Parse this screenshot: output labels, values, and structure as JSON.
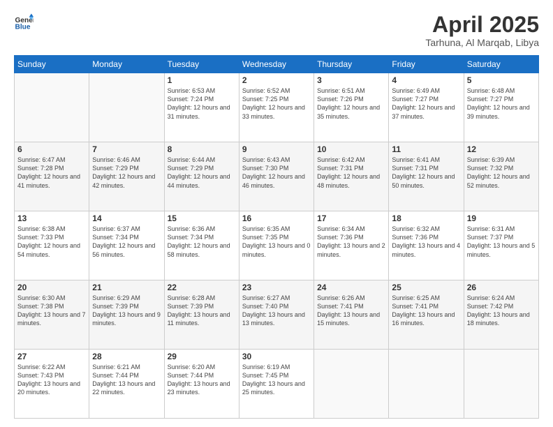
{
  "header": {
    "logo": {
      "line1": "General",
      "line2": "Blue"
    },
    "title": "April 2025",
    "subtitle": "Tarhuna, Al Marqab, Libya"
  },
  "weekdays": [
    "Sunday",
    "Monday",
    "Tuesday",
    "Wednesday",
    "Thursday",
    "Friday",
    "Saturday"
  ],
  "weeks": [
    [
      {
        "day": "",
        "sunrise": "",
        "sunset": "",
        "daylight": ""
      },
      {
        "day": "",
        "sunrise": "",
        "sunset": "",
        "daylight": ""
      },
      {
        "day": "1",
        "sunrise": "Sunrise: 6:53 AM",
        "sunset": "Sunset: 7:24 PM",
        "daylight": "Daylight: 12 hours and 31 minutes."
      },
      {
        "day": "2",
        "sunrise": "Sunrise: 6:52 AM",
        "sunset": "Sunset: 7:25 PM",
        "daylight": "Daylight: 12 hours and 33 minutes."
      },
      {
        "day": "3",
        "sunrise": "Sunrise: 6:51 AM",
        "sunset": "Sunset: 7:26 PM",
        "daylight": "Daylight: 12 hours and 35 minutes."
      },
      {
        "day": "4",
        "sunrise": "Sunrise: 6:49 AM",
        "sunset": "Sunset: 7:27 PM",
        "daylight": "Daylight: 12 hours and 37 minutes."
      },
      {
        "day": "5",
        "sunrise": "Sunrise: 6:48 AM",
        "sunset": "Sunset: 7:27 PM",
        "daylight": "Daylight: 12 hours and 39 minutes."
      }
    ],
    [
      {
        "day": "6",
        "sunrise": "Sunrise: 6:47 AM",
        "sunset": "Sunset: 7:28 PM",
        "daylight": "Daylight: 12 hours and 41 minutes."
      },
      {
        "day": "7",
        "sunrise": "Sunrise: 6:46 AM",
        "sunset": "Sunset: 7:29 PM",
        "daylight": "Daylight: 12 hours and 42 minutes."
      },
      {
        "day": "8",
        "sunrise": "Sunrise: 6:44 AM",
        "sunset": "Sunset: 7:29 PM",
        "daylight": "Daylight: 12 hours and 44 minutes."
      },
      {
        "day": "9",
        "sunrise": "Sunrise: 6:43 AM",
        "sunset": "Sunset: 7:30 PM",
        "daylight": "Daylight: 12 hours and 46 minutes."
      },
      {
        "day": "10",
        "sunrise": "Sunrise: 6:42 AM",
        "sunset": "Sunset: 7:31 PM",
        "daylight": "Daylight: 12 hours and 48 minutes."
      },
      {
        "day": "11",
        "sunrise": "Sunrise: 6:41 AM",
        "sunset": "Sunset: 7:31 PM",
        "daylight": "Daylight: 12 hours and 50 minutes."
      },
      {
        "day": "12",
        "sunrise": "Sunrise: 6:39 AM",
        "sunset": "Sunset: 7:32 PM",
        "daylight": "Daylight: 12 hours and 52 minutes."
      }
    ],
    [
      {
        "day": "13",
        "sunrise": "Sunrise: 6:38 AM",
        "sunset": "Sunset: 7:33 PM",
        "daylight": "Daylight: 12 hours and 54 minutes."
      },
      {
        "day": "14",
        "sunrise": "Sunrise: 6:37 AM",
        "sunset": "Sunset: 7:34 PM",
        "daylight": "Daylight: 12 hours and 56 minutes."
      },
      {
        "day": "15",
        "sunrise": "Sunrise: 6:36 AM",
        "sunset": "Sunset: 7:34 PM",
        "daylight": "Daylight: 12 hours and 58 minutes."
      },
      {
        "day": "16",
        "sunrise": "Sunrise: 6:35 AM",
        "sunset": "Sunset: 7:35 PM",
        "daylight": "Daylight: 13 hours and 0 minutes."
      },
      {
        "day": "17",
        "sunrise": "Sunrise: 6:34 AM",
        "sunset": "Sunset: 7:36 PM",
        "daylight": "Daylight: 13 hours and 2 minutes."
      },
      {
        "day": "18",
        "sunrise": "Sunrise: 6:32 AM",
        "sunset": "Sunset: 7:36 PM",
        "daylight": "Daylight: 13 hours and 4 minutes."
      },
      {
        "day": "19",
        "sunrise": "Sunrise: 6:31 AM",
        "sunset": "Sunset: 7:37 PM",
        "daylight": "Daylight: 13 hours and 5 minutes."
      }
    ],
    [
      {
        "day": "20",
        "sunrise": "Sunrise: 6:30 AM",
        "sunset": "Sunset: 7:38 PM",
        "daylight": "Daylight: 13 hours and 7 minutes."
      },
      {
        "day": "21",
        "sunrise": "Sunrise: 6:29 AM",
        "sunset": "Sunset: 7:39 PM",
        "daylight": "Daylight: 13 hours and 9 minutes."
      },
      {
        "day": "22",
        "sunrise": "Sunrise: 6:28 AM",
        "sunset": "Sunset: 7:39 PM",
        "daylight": "Daylight: 13 hours and 11 minutes."
      },
      {
        "day": "23",
        "sunrise": "Sunrise: 6:27 AM",
        "sunset": "Sunset: 7:40 PM",
        "daylight": "Daylight: 13 hours and 13 minutes."
      },
      {
        "day": "24",
        "sunrise": "Sunrise: 6:26 AM",
        "sunset": "Sunset: 7:41 PM",
        "daylight": "Daylight: 13 hours and 15 minutes."
      },
      {
        "day": "25",
        "sunrise": "Sunrise: 6:25 AM",
        "sunset": "Sunset: 7:41 PM",
        "daylight": "Daylight: 13 hours and 16 minutes."
      },
      {
        "day": "26",
        "sunrise": "Sunrise: 6:24 AM",
        "sunset": "Sunset: 7:42 PM",
        "daylight": "Daylight: 13 hours and 18 minutes."
      }
    ],
    [
      {
        "day": "27",
        "sunrise": "Sunrise: 6:22 AM",
        "sunset": "Sunset: 7:43 PM",
        "daylight": "Daylight: 13 hours and 20 minutes."
      },
      {
        "day": "28",
        "sunrise": "Sunrise: 6:21 AM",
        "sunset": "Sunset: 7:44 PM",
        "daylight": "Daylight: 13 hours and 22 minutes."
      },
      {
        "day": "29",
        "sunrise": "Sunrise: 6:20 AM",
        "sunset": "Sunset: 7:44 PM",
        "daylight": "Daylight: 13 hours and 23 minutes."
      },
      {
        "day": "30",
        "sunrise": "Sunrise: 6:19 AM",
        "sunset": "Sunset: 7:45 PM",
        "daylight": "Daylight: 13 hours and 25 minutes."
      },
      {
        "day": "",
        "sunrise": "",
        "sunset": "",
        "daylight": ""
      },
      {
        "day": "",
        "sunrise": "",
        "sunset": "",
        "daylight": ""
      },
      {
        "day": "",
        "sunrise": "",
        "sunset": "",
        "daylight": ""
      }
    ]
  ]
}
